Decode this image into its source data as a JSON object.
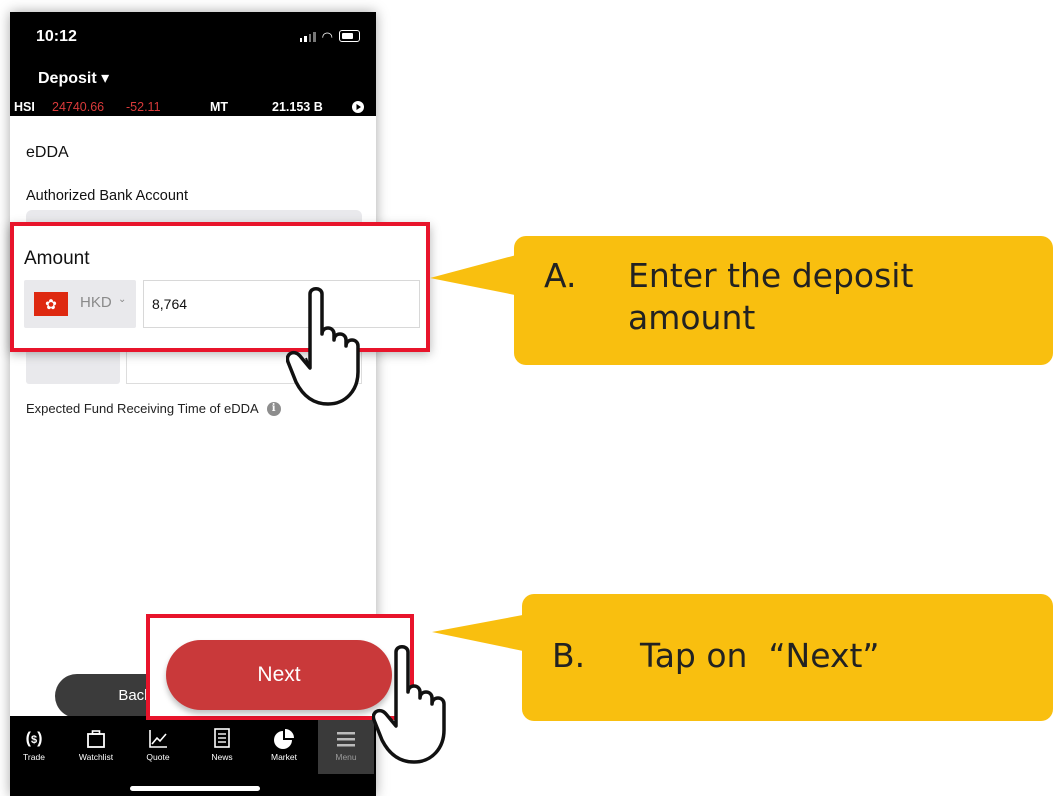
{
  "status_bar": {
    "time": "10:12"
  },
  "header": {
    "title": "Deposit ▾"
  },
  "ticker": {
    "index": "HSI",
    "value": "24740.66",
    "change": "-52.11",
    "label": "MT",
    "turnover": "21.153 B"
  },
  "form": {
    "section": "eDDA",
    "bank_account_label": "Authorized Bank Account",
    "amount_label": "Amount",
    "currency": "HKD",
    "amount_value": "8,764",
    "expected_time_label": "Expected Fund Receiving Time of eDDA"
  },
  "buttons": {
    "back": "Back",
    "next": "Next"
  },
  "tabs": [
    {
      "label": "Trade",
      "icon": "trade-icon"
    },
    {
      "label": "Watchlist",
      "icon": "briefcase-icon"
    },
    {
      "label": "Quote",
      "icon": "chart-icon"
    },
    {
      "label": "News",
      "icon": "news-icon"
    },
    {
      "label": "Market",
      "icon": "pie-chart-icon"
    },
    {
      "label": "Menu",
      "icon": "menu-icon"
    }
  ],
  "callouts": {
    "a_marker": "A.",
    "a_line1": "Enter the deposit",
    "a_line2": "amount",
    "b_marker": "B.",
    "b_text": "Tap on  “Next”"
  },
  "colors": {
    "highlight_frame": "#e8142b",
    "callout": "#f9bf0f",
    "next_button": "#c9393a"
  }
}
